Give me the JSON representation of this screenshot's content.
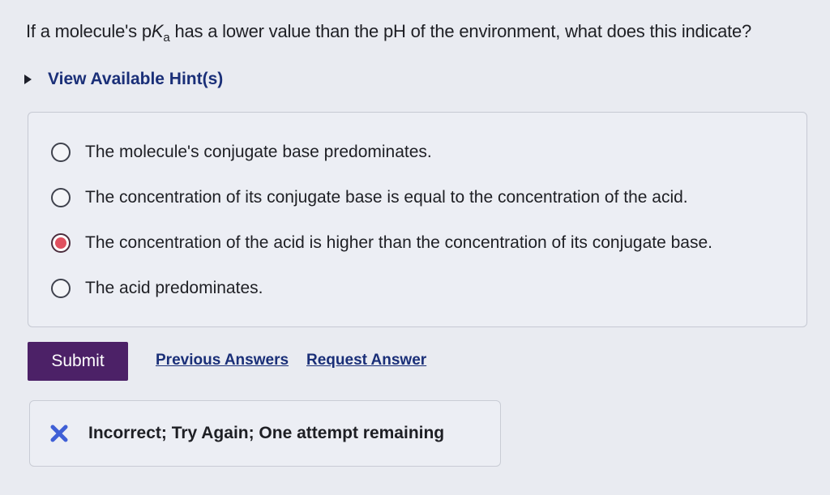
{
  "question": {
    "prefix": "If a molecule's p",
    "k": "K",
    "sub": "a",
    "suffix": " has a lower value than the pH of the environment, what does this indicate?"
  },
  "hint": {
    "label": "View Available Hint(s)"
  },
  "choices": [
    {
      "label": "The molecule's conjugate base predominates.",
      "selected": false
    },
    {
      "label": "The concentration of its conjugate base is equal to the concentration of the acid.",
      "selected": false
    },
    {
      "label": "The concentration of the acid is higher than the concentration of its conjugate base.",
      "selected": true
    },
    {
      "label": "The acid predominates.",
      "selected": false
    }
  ],
  "actions": {
    "submit_label": "Submit",
    "previous_answers_label": "Previous Answers",
    "request_answer_label": "Request Answer"
  },
  "feedback": {
    "icon": "x-mark-icon",
    "message": "Incorrect; Try Again; One attempt remaining",
    "icon_color": "#3f5fd6"
  },
  "colors": {
    "submit_bg": "#4c2167",
    "link": "#1a2f78",
    "radio_selected": "#e0505f"
  }
}
